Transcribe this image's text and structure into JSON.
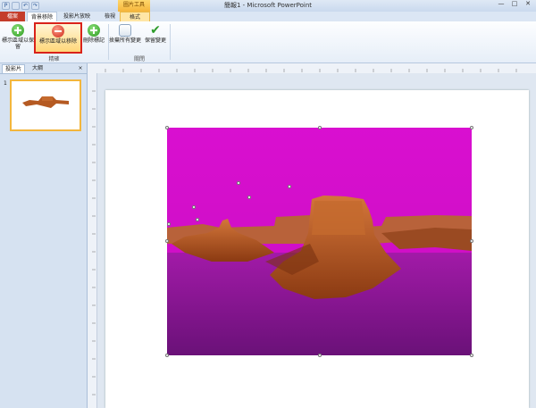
{
  "window": {
    "title": "簡報1 - Microsoft PowerPoint",
    "context_group": "圖片工具",
    "controls": [
      "—",
      "□",
      "✕"
    ]
  },
  "tabs": {
    "file": "檔案",
    "background_removal": "背景移除",
    "slideshow": "投影片放映",
    "view": "檢視",
    "format": "格式"
  },
  "ribbon": {
    "keep_label": "標示區域以保留",
    "remove_label": "標示區域以移除",
    "delete_label": "刪除標記",
    "discard_label": "捨棄所有變更",
    "save_label": "保留變更",
    "group_refine": "精確",
    "group_close": "關閉"
  },
  "left_pane": {
    "tab_slides": "投影片",
    "tab_outline": "大綱",
    "close": "×",
    "slide_number": "1"
  },
  "colors": {
    "removed_area_magenta": "#d511c9",
    "highlight_red": "#d9221a",
    "file_tab": "#c43c2a"
  },
  "icons": {
    "keep": "green-plus-circle-icon",
    "remove": "red-minus-circle-icon",
    "delete": "eraser-icon",
    "discard": "discard-icon",
    "save": "green-checkmark-icon"
  }
}
